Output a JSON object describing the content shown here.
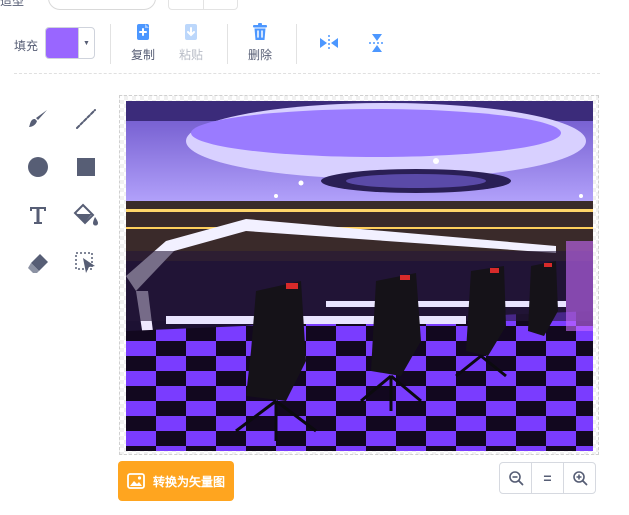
{
  "top": {
    "label": "造型"
  },
  "toolbar": {
    "fill_label": "填充",
    "fill_color": "#9966ff",
    "copy_label": "复制",
    "paste_label": "粘贴",
    "delete_label": "删除"
  },
  "tools": [
    "brush-icon",
    "line-icon",
    "circle-icon",
    "rectangle-icon",
    "text-icon",
    "fill-bucket-icon",
    "eraser-icon",
    "select-icon"
  ],
  "bottom": {
    "convert_label": "转换为矢量图",
    "convert_color": "#ffa51f",
    "zoom_reset_label": "="
  },
  "colors": {
    "accent_blue": "#4c97ff",
    "text": "#575e75"
  }
}
